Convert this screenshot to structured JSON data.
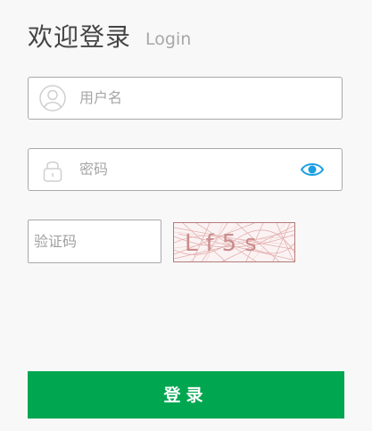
{
  "header": {
    "title": "欢迎登录",
    "subtitle": "Login"
  },
  "username": {
    "placeholder": "用户名",
    "icon": "user-icon"
  },
  "password": {
    "placeholder": "密码",
    "icon": "lock-icon",
    "toggle_icon": "eye-icon"
  },
  "captcha": {
    "placeholder": "验证码",
    "code_text": "Lf5s"
  },
  "login_button": {
    "label": "登录"
  },
  "colors": {
    "accent_green": "#00a650",
    "eye_blue": "#1a9fe0",
    "captcha_ink": "#c98c8c"
  }
}
